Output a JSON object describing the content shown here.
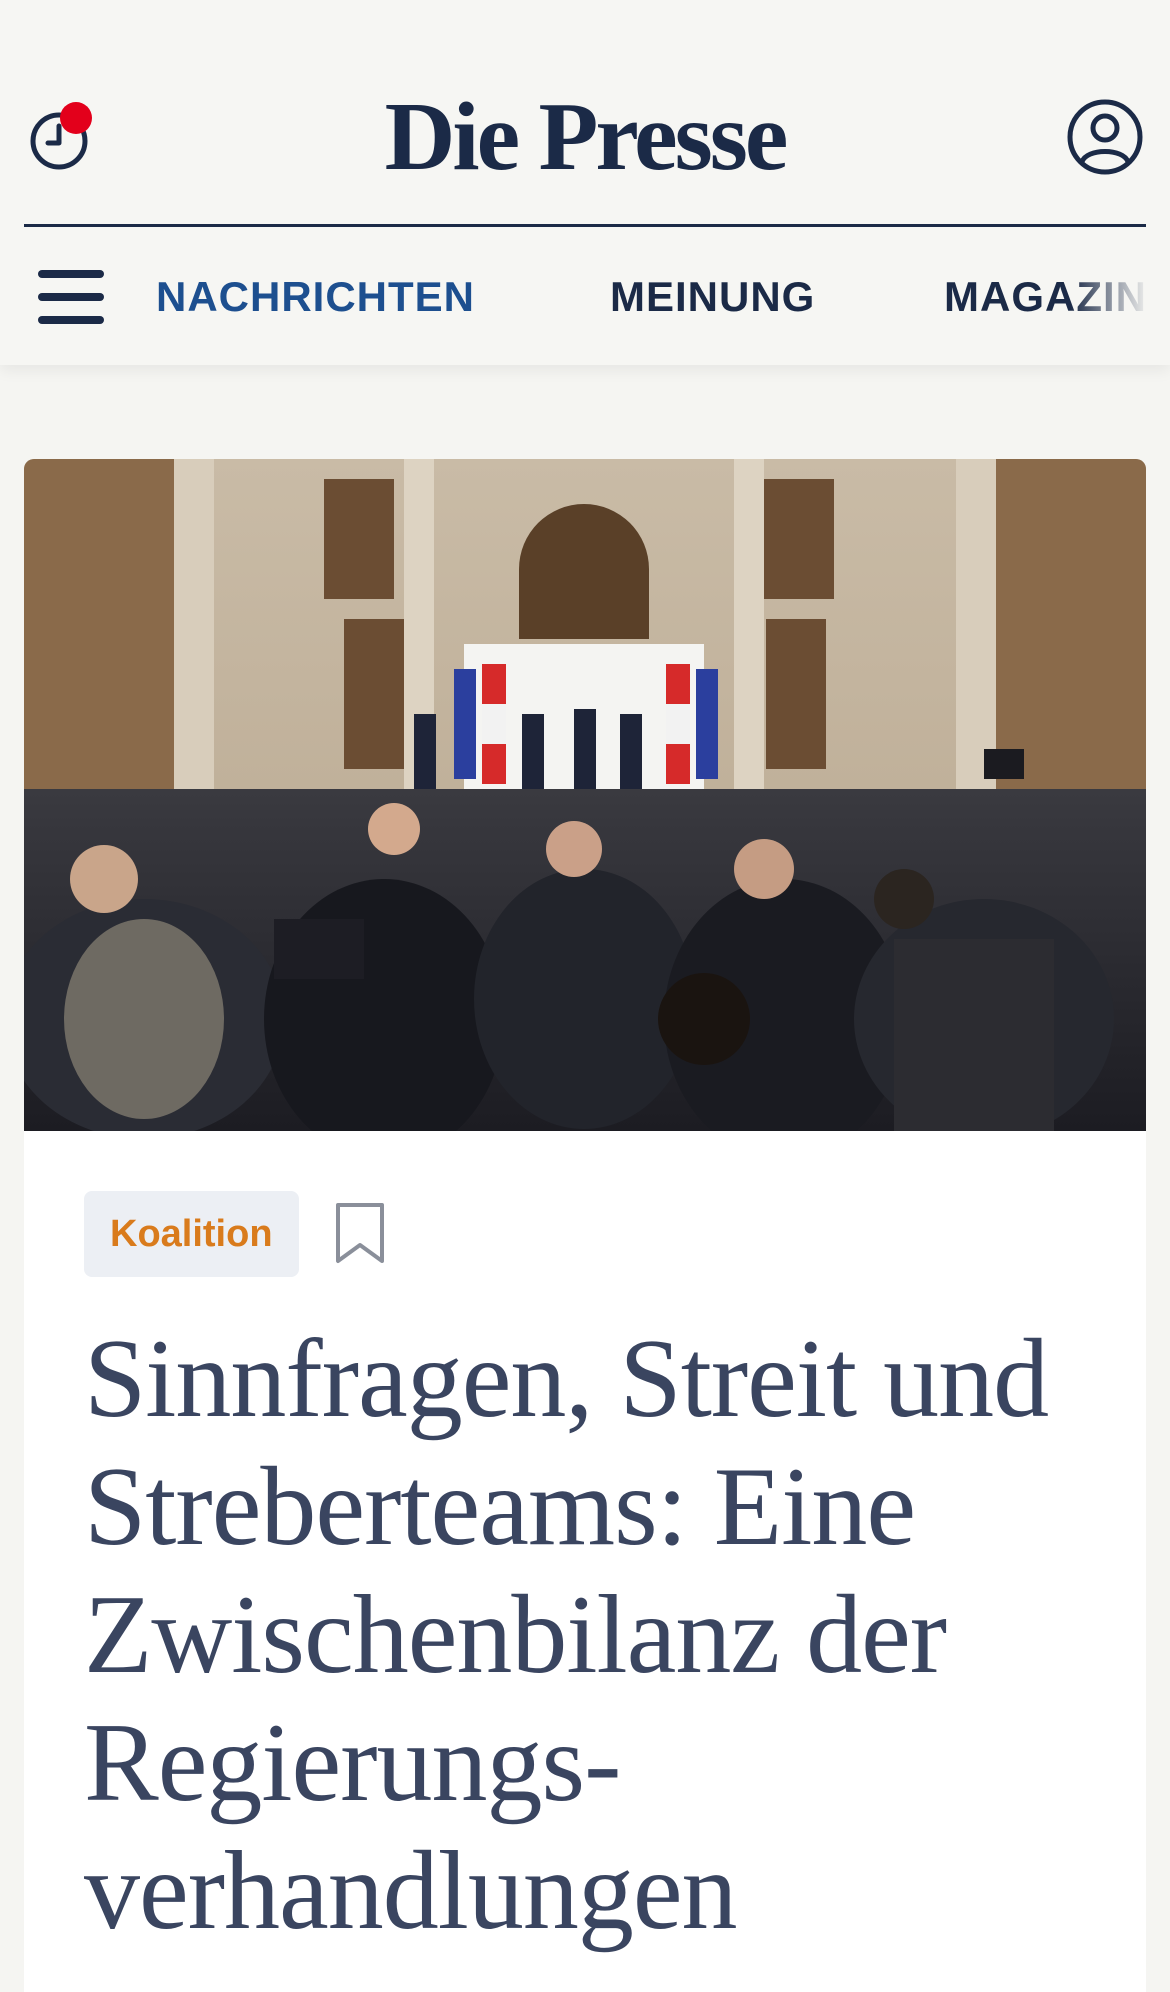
{
  "header": {
    "logo": "Die Presse",
    "history_icon": "clock-icon",
    "account_icon": "user-circle-icon"
  },
  "nav": {
    "menu_icon": "hamburger-menu-icon",
    "tabs": [
      {
        "label": "NACHRICHTEN",
        "active": true
      },
      {
        "label": "MEINUNG",
        "active": false
      },
      {
        "label": "MAGAZIN",
        "active": false
      }
    ]
  },
  "article": {
    "tag": "Koalition",
    "bookmark_icon": "bookmark-icon",
    "headline": "Sinnfragen, Streit und Streberteams: Eine Zwischenbilanz der Regierungs­verhandlungen"
  },
  "colors": {
    "brand_navy": "#1b2a47",
    "nav_active": "#1d4f8f",
    "tag_orange": "#d97b1c",
    "notification_red": "#e3001b",
    "headline": "#3a4560"
  }
}
